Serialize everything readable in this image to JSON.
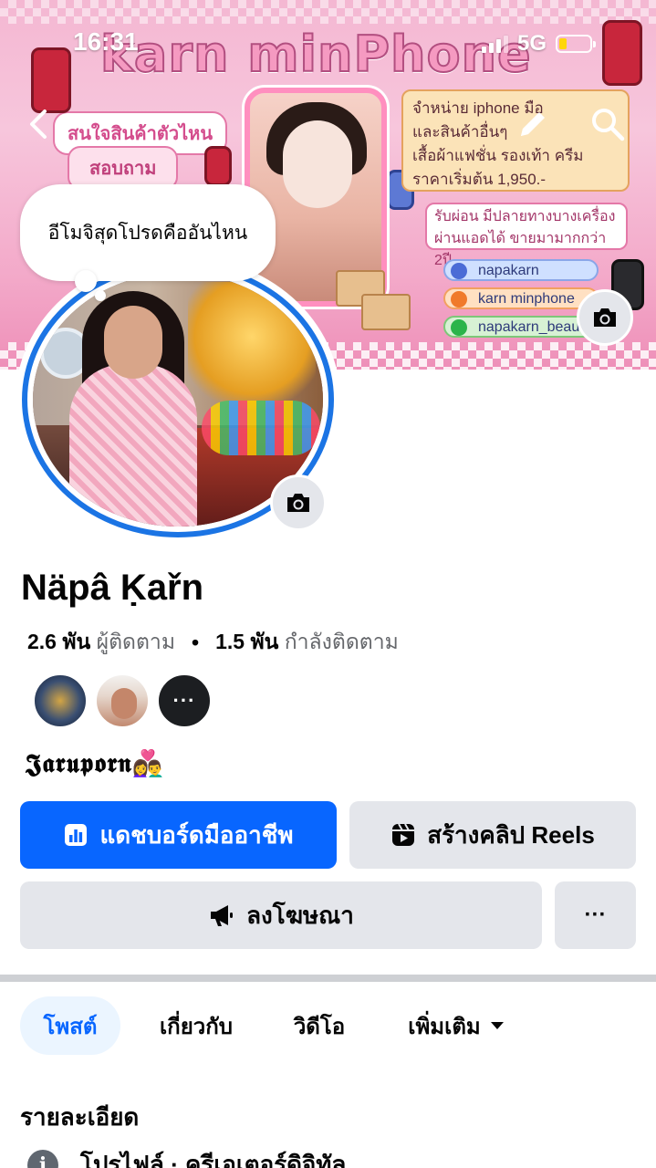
{
  "status_bar": {
    "time": "16:31",
    "network": "5G",
    "battery_level": 0.25
  },
  "cover": {
    "shop_title": "karn minPhone",
    "tag_text": "สนใจสินค้าตัวไหน",
    "ask_text": "สอบถาม",
    "info_line1": "จำหน่าย iphone มือ",
    "info_line2": "และสินค้าอื่นๆ",
    "info_line3": "เสื้อผ้าแฟชั่น รองเท้า ครีม",
    "info_line4": "ราคาเริ่มต้น 1,950.-",
    "promo_line1": "รับผ่อน มีปลายทางบางเครื่อง",
    "promo_line2": "ผ่านแอดได้ ขายมามากกว่า 2ปี",
    "social_facebook": "napakarn",
    "social_messenger": "karn minphone",
    "social_line": "napakarn_beauty"
  },
  "bubble": {
    "text": "อีโมจิสุดโปรดคืออันไหน"
  },
  "profile": {
    "name": "Näpâ Ḳařn",
    "followers_count": "2.6 พัน",
    "followers_label": "ผู้ติดตาม",
    "separator": "•",
    "following_count": "1.5 พัน",
    "following_label": "กำลังติดตาม",
    "friends_more": "···",
    "bio": "𝕵𝖆𝖗𝖚𝖕𝖔𝖗𝖓👩‍❤️‍👨"
  },
  "buttons": {
    "dashboard": "แดชบอร์ดมืออาชีพ",
    "reels": "สร้างคลิป Reels",
    "ads": "ลงโฆษณา",
    "more": "···"
  },
  "tabs": [
    {
      "label": "โพสต์"
    },
    {
      "label": "เกี่ยวกับ"
    },
    {
      "label": "วิดีโอ"
    },
    {
      "label": "เพิ่มเติม"
    }
  ],
  "details": {
    "title": "รายละเอียด",
    "row1": "โปรไฟล์ · ครีเอเตอร์ดิจิทัล"
  },
  "colors": {
    "brand_blue": "#0866ff",
    "button_gray": "#e4e6eb",
    "text_secondary": "#65676b"
  },
  "icons": [
    "back-icon",
    "edit-icon",
    "search-icon",
    "camera-icon",
    "dashboard-icon",
    "reels-icon",
    "megaphone-icon",
    "caret-down-icon",
    "info-icon"
  ]
}
